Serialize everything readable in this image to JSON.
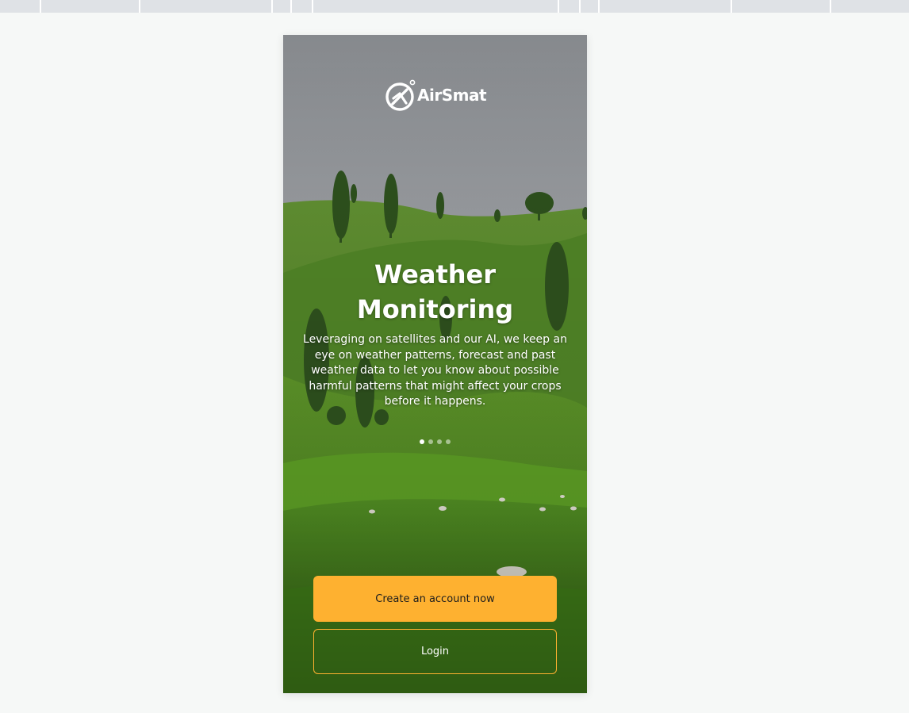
{
  "brand": {
    "name": "AirSmat",
    "logo_icon": "airsmat-logo-icon"
  },
  "slide": {
    "title_line1": "Weather",
    "title_line2": "Monitoring",
    "description": "Leveraging on satellites and our AI, we keep an eye on weather patterns, forecast and past weather data to let you know about possible harmful patterns that might affect your crops before it happens."
  },
  "carousel": {
    "total": 4,
    "active_index": 0
  },
  "actions": {
    "create_account_label": "Create an account now",
    "login_label": "Login"
  },
  "colors": {
    "accent": "#feb130",
    "page_background": "#f6f8f7"
  }
}
